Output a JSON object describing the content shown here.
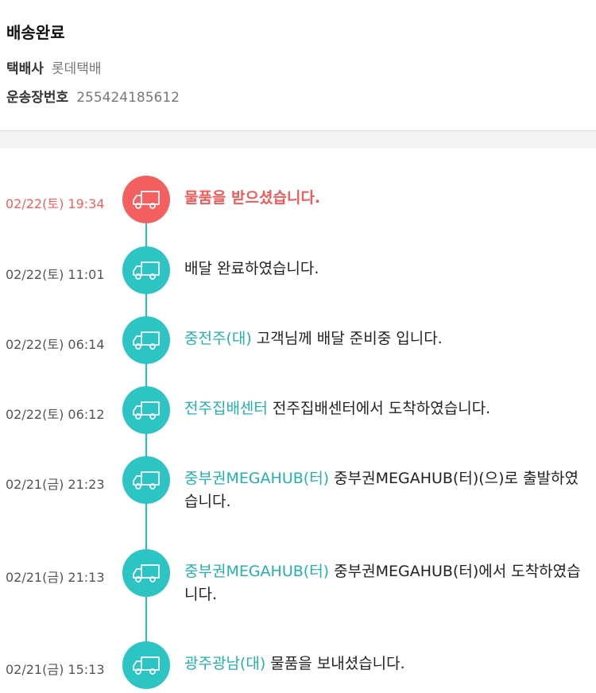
{
  "header": {
    "status": "배송완료",
    "courier_label": "택배사",
    "courier_value": "롯데택배",
    "tracking_label": "운송장번호",
    "tracking_value": "255424185612"
  },
  "colors": {
    "accent": "#2cc5c4",
    "alert": "#f46060",
    "location": "#22b0b3"
  },
  "events": [
    {
      "time": "02/22(토) 19:34",
      "location": "",
      "text": "물품을 받으셨습니다.",
      "icon": "truck-icon"
    },
    {
      "time": "02/22(토) 11:01",
      "location": "",
      "text": "배달 완료하였습니다.",
      "icon": "truck-icon"
    },
    {
      "time": "02/22(토) 06:14",
      "location": "중전주(대)",
      "text": " 고객님께 배달 준비중 입니다.",
      "icon": "truck-icon"
    },
    {
      "time": "02/22(토) 06:12",
      "location": "전주집배센터",
      "text": " 전주집배센터에서 도착하였습니다.",
      "icon": "truck-icon"
    },
    {
      "time": "02/21(금) 21:23",
      "location": "중부권MEGAHUB(터)",
      "text": " 중부권MEGAHUB(터)(으)로 출발하였습니다.",
      "icon": "truck-icon"
    },
    {
      "time": "02/21(금) 21:13",
      "location": "중부권MEGAHUB(터)",
      "text": " 중부권MEGAHUB(터)에서 도착하였습니다.",
      "icon": "truck-icon"
    },
    {
      "time": "02/21(금) 15:13",
      "location": "광주광남(대)",
      "text": " 물품을 보내셨습니다.",
      "icon": "truck-icon"
    }
  ]
}
